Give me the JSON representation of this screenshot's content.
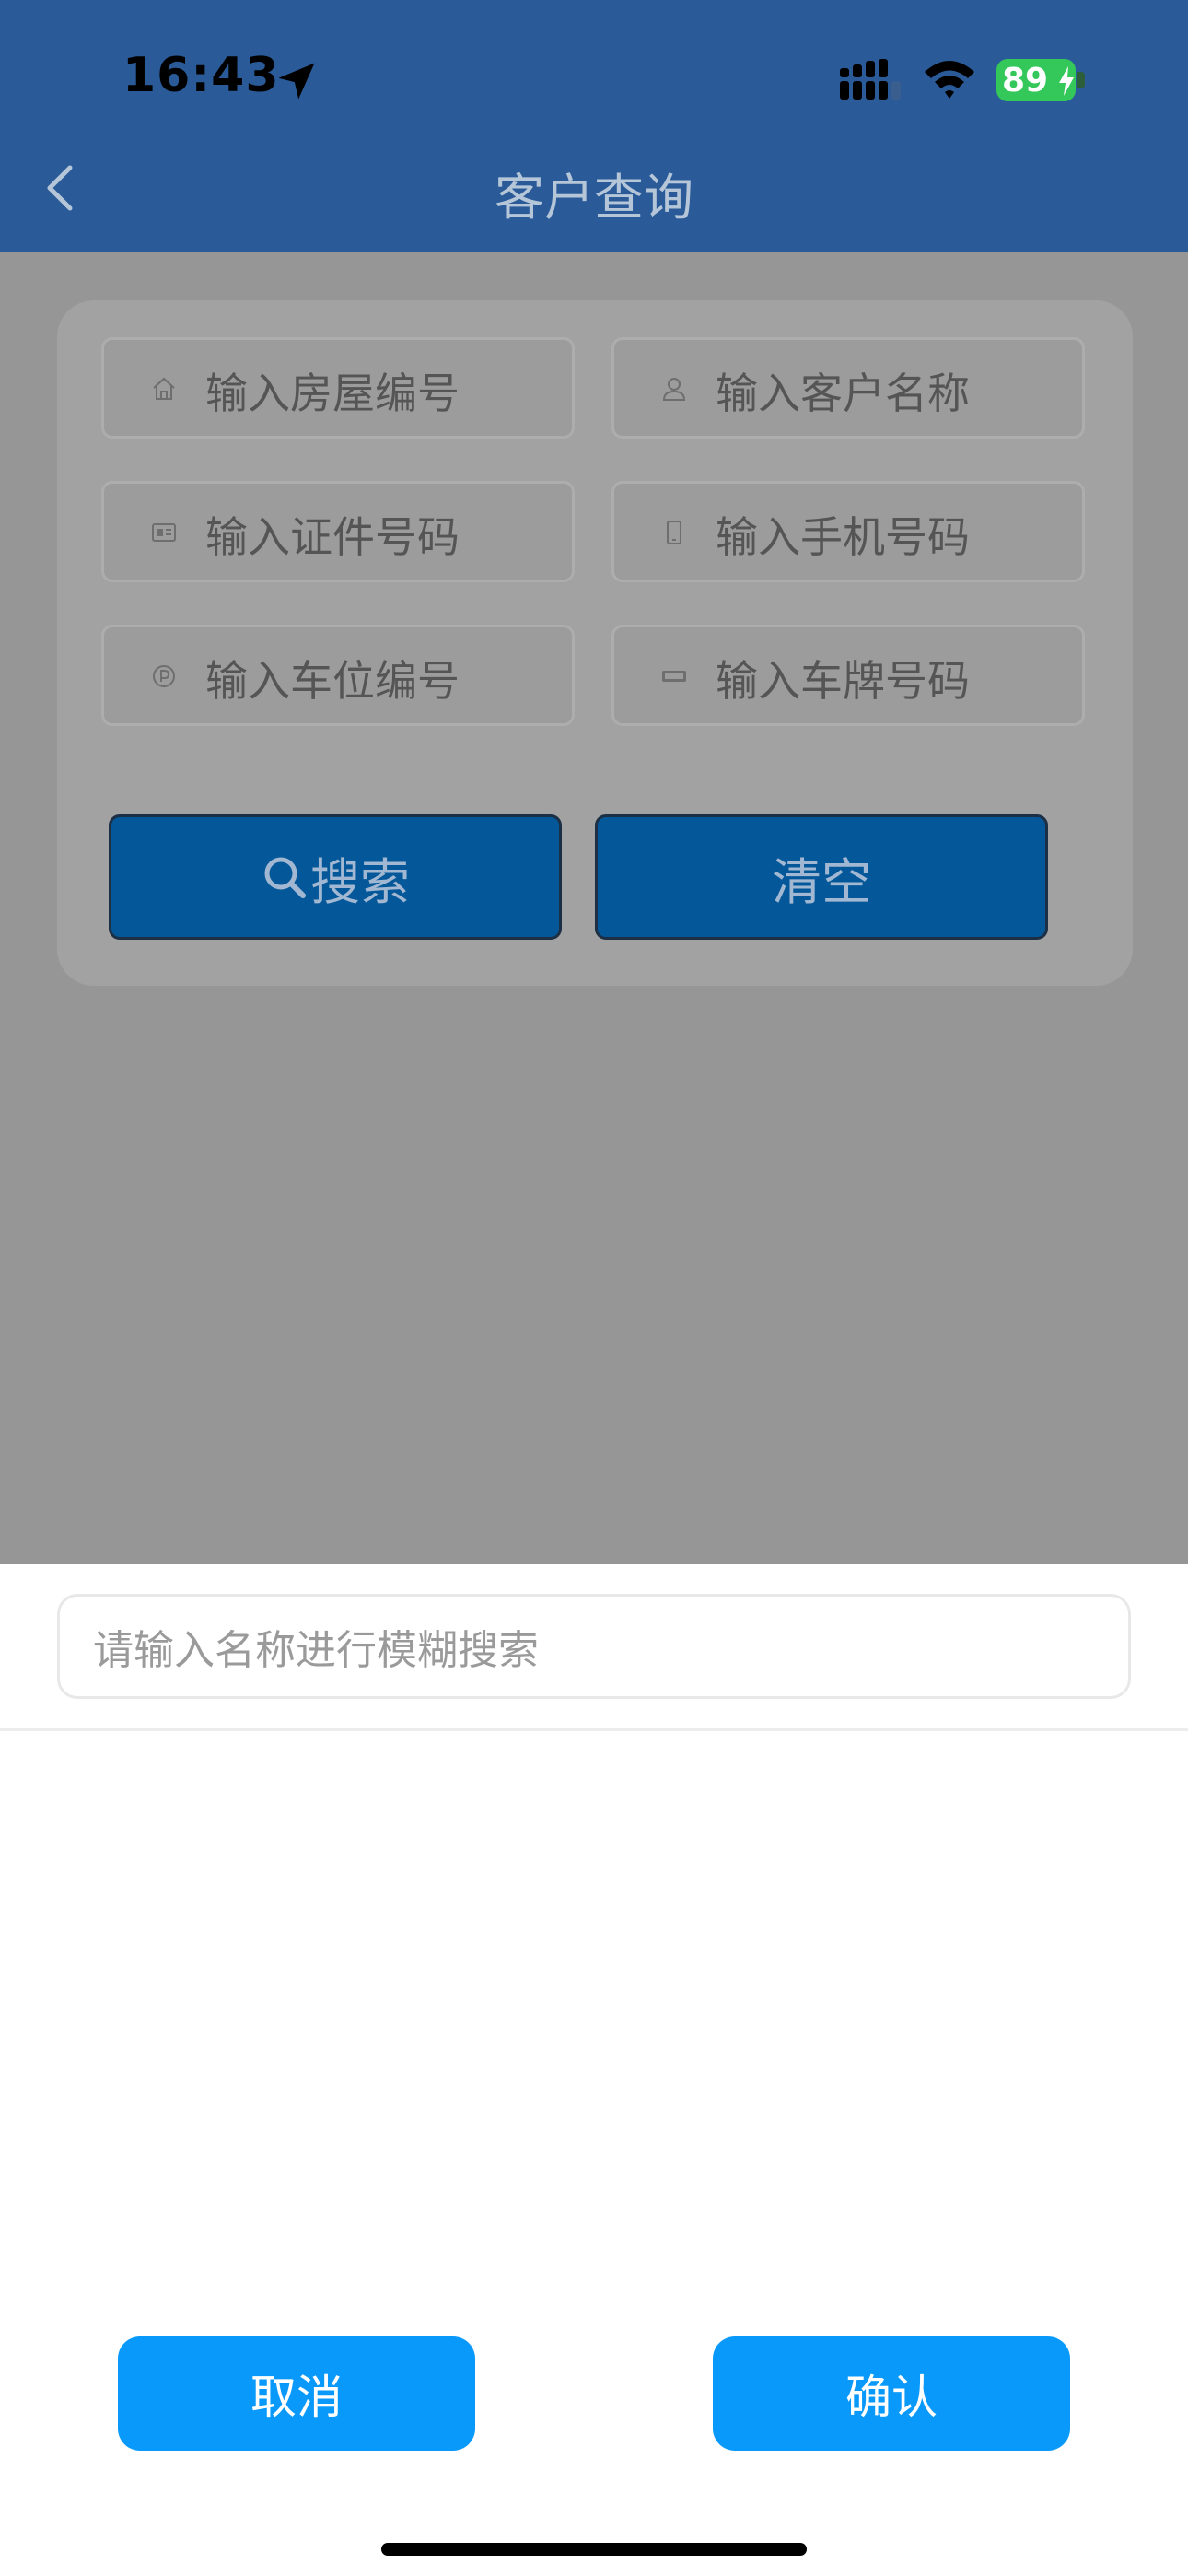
{
  "status_bar": {
    "time": "16:43",
    "battery_level": "89"
  },
  "header": {
    "title": "客户查询"
  },
  "form": {
    "fields": [
      {
        "placeholder": "输入房屋编号",
        "icon": "house-icon"
      },
      {
        "placeholder": "输入客户名称",
        "icon": "person-icon"
      },
      {
        "placeholder": "输入证件号码",
        "icon": "id-card-icon"
      },
      {
        "placeholder": "输入手机号码",
        "icon": "phone-icon"
      },
      {
        "placeholder": "输入车位编号",
        "icon": "parking-icon"
      },
      {
        "placeholder": "输入车牌号码",
        "icon": "license-plate-icon"
      }
    ],
    "search_label": "搜索",
    "clear_label": "清空"
  },
  "sheet": {
    "search_placeholder": "请输入名称进行模糊搜索",
    "cancel_label": "取消",
    "confirm_label": "确认"
  },
  "colors": {
    "header_bg": "#2a5b98",
    "overlay_bg": "#969696",
    "primary_button": "#0899fb",
    "battery": "#34c759"
  }
}
